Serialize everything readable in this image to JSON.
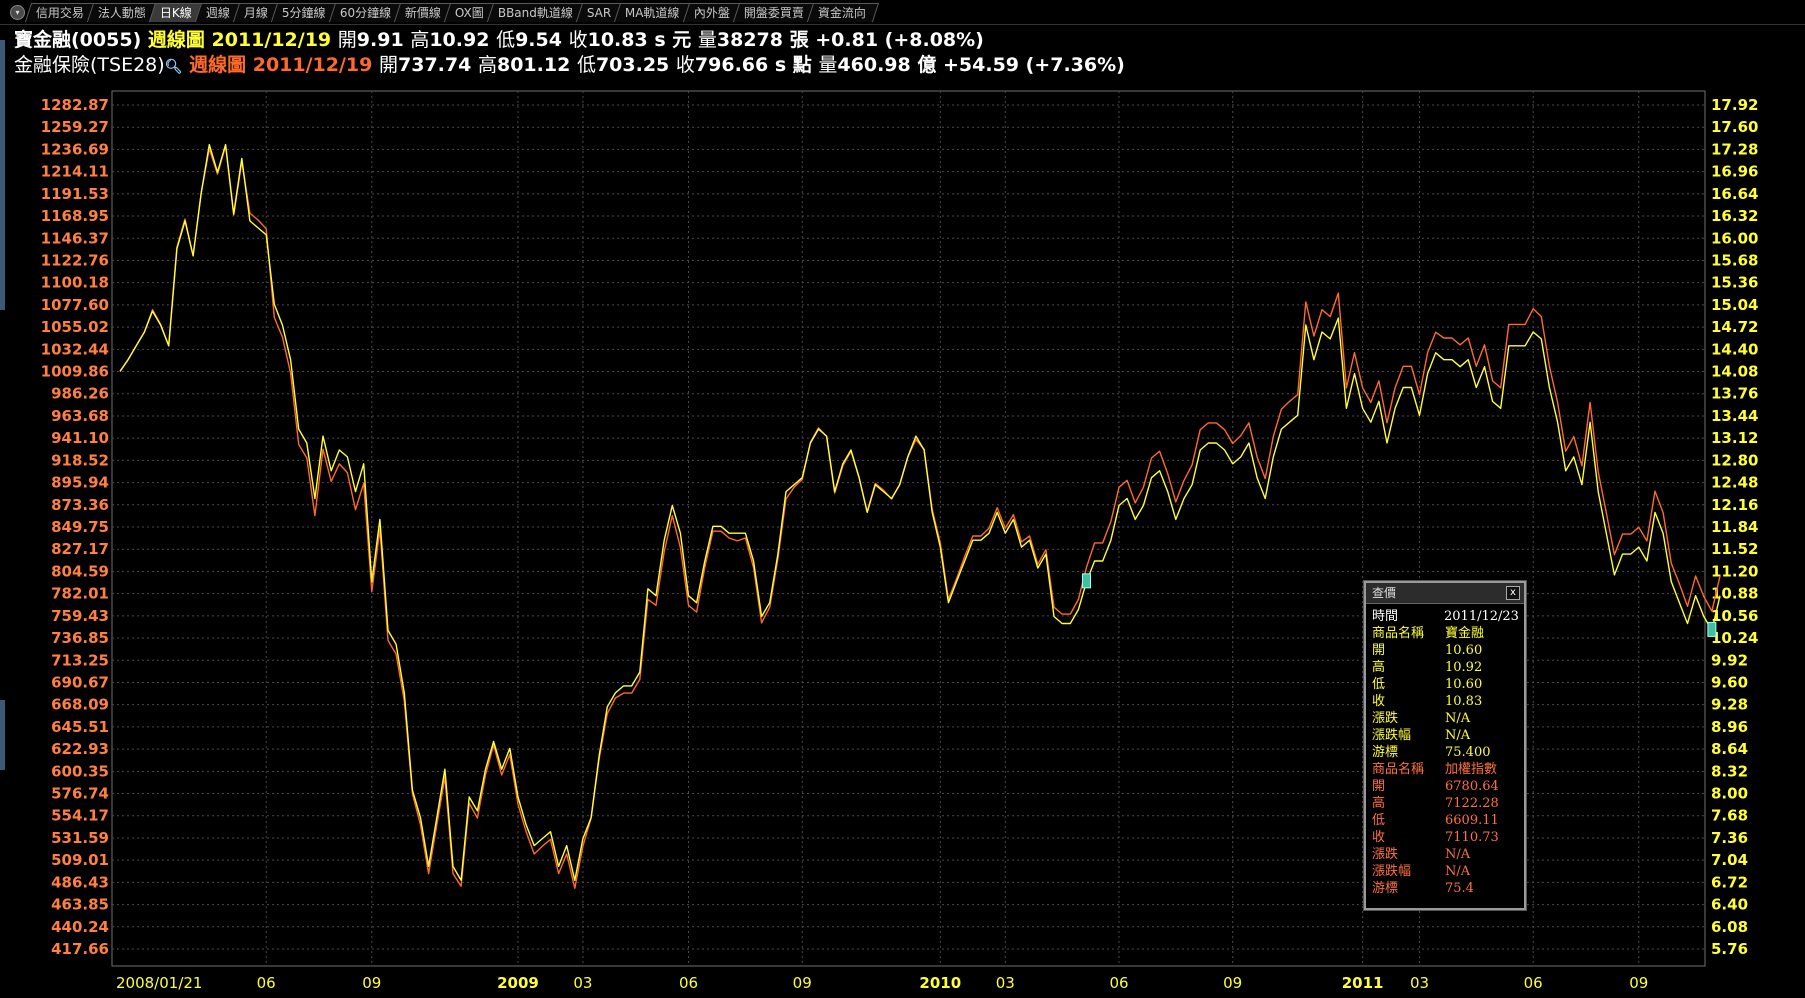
{
  "tabs": [
    {
      "label": "信用交易",
      "active": false
    },
    {
      "label": "法人動態",
      "active": false
    },
    {
      "label": "日K線",
      "active": true
    },
    {
      "label": "週線",
      "active": false
    },
    {
      "label": "月線",
      "active": false
    },
    {
      "label": "5分鐘線",
      "active": false
    },
    {
      "label": "60分鐘線",
      "active": false
    },
    {
      "label": "新價線",
      "active": false
    },
    {
      "label": "OX圖",
      "active": false
    },
    {
      "label": "BBand軌道線",
      "active": false
    },
    {
      "label": "SAR",
      "active": false
    },
    {
      "label": "MA軌道線",
      "active": false
    },
    {
      "label": "內外盤",
      "active": false
    },
    {
      "label": "開盤委買賣",
      "active": false
    },
    {
      "label": "資金流向",
      "active": false
    }
  ],
  "stock": {
    "name": "寶金融(0055)",
    "period": "週線圖",
    "date": "2011/12/19",
    "open_label": "開",
    "open": "9.91",
    "high_label": "高",
    "high": "10.92",
    "low_label": "低",
    "low": "9.54",
    "close_label": "收",
    "close": "10.83 s 元",
    "vol_label": "量",
    "vol": "38278 張",
    "change": "+0.81 (+8.08%)"
  },
  "index": {
    "name": "金融保險(TSE28)",
    "period": "週線圖",
    "date": "2011/12/19",
    "open_label": "開",
    "open": "737.74",
    "high_label": "高",
    "high": "801.12",
    "low_label": "低",
    "low": "703.25",
    "close_label": "收",
    "close": "796.66 s 點",
    "vol_label": "量",
    "vol": "460.98 億",
    "change": "+54.59 (+7.36%)"
  },
  "popup": {
    "title": "查價",
    "close": "x",
    "rows": [
      {
        "k": "時間",
        "v": "2011/12/23",
        "c": "w"
      },
      {
        "k": "商品名稱",
        "v": "寶金融",
        "c": "y"
      },
      {
        "k": "開",
        "v": "10.60",
        "c": "y"
      },
      {
        "k": "高",
        "v": "10.92",
        "c": "y"
      },
      {
        "k": "低",
        "v": "10.60",
        "c": "y"
      },
      {
        "k": "收",
        "v": "10.83",
        "c": "y"
      },
      {
        "k": "漲跌",
        "v": "N/A",
        "c": "y"
      },
      {
        "k": "漲跌幅",
        "v": "N/A",
        "c": "y"
      },
      {
        "k": "游標",
        "v": "75.400",
        "c": "y"
      },
      {
        "k": "商品名稱",
        "v": "加權指數",
        "c": "o"
      },
      {
        "k": "開",
        "v": "6780.64",
        "c": "o"
      },
      {
        "k": "高",
        "v": "7122.28",
        "c": "o"
      },
      {
        "k": "低",
        "v": "6609.11",
        "c": "o"
      },
      {
        "k": "收",
        "v": "7110.73",
        "c": "o"
      },
      {
        "k": "漲跌",
        "v": "N/A",
        "c": "o"
      },
      {
        "k": "漲跌幅",
        "v": "N/A",
        "c": "o"
      },
      {
        "k": "游標",
        "v": "75.4",
        "c": "o"
      }
    ]
  },
  "chart_data": {
    "type": "line",
    "title": "",
    "xlabel": "",
    "ylabel": "",
    "grid": true,
    "x_ticks": [
      {
        "label": "2008/01/21",
        "i": 0,
        "bold": false
      },
      {
        "label": "06",
        "i": 18,
        "bold": false
      },
      {
        "label": "09",
        "i": 31,
        "bold": false
      },
      {
        "label": "2009",
        "i": 49,
        "bold": true
      },
      {
        "label": "03",
        "i": 57,
        "bold": false
      },
      {
        "label": "06",
        "i": 70,
        "bold": false
      },
      {
        "label": "09",
        "i": 84,
        "bold": false
      },
      {
        "label": "2010",
        "i": 101,
        "bold": true
      },
      {
        "label": "03",
        "i": 109,
        "bold": false
      },
      {
        "label": "06",
        "i": 123,
        "bold": false
      },
      {
        "label": "09",
        "i": 137,
        "bold": false
      },
      {
        "label": "2011",
        "i": 153,
        "bold": true
      },
      {
        "label": "03",
        "i": 160,
        "bold": false
      },
      {
        "label": "06",
        "i": 174,
        "bold": false
      },
      {
        "label": "09",
        "i": 187,
        "bold": false
      }
    ],
    "left_axis": {
      "color": "#ff8040",
      "ylim": [
        417.66,
        1282.87
      ],
      "ticks": [
        "1282.87",
        "1259.27",
        "1236.69",
        "1214.11",
        "1191.53",
        "1168.95",
        "1146.37",
        "1122.76",
        "1100.18",
        "1077.60",
        "1055.02",
        "1032.44",
        "1009.86",
        "986.26",
        "963.68",
        "941.10",
        "918.52",
        "895.94",
        "873.36",
        "849.75",
        "827.17",
        "804.59",
        "782.01",
        "759.43",
        "736.85",
        "713.25",
        "690.67",
        "668.09",
        "645.51",
        "622.93",
        "600.35",
        "576.74",
        "554.17",
        "531.59",
        "509.01",
        "486.43",
        "463.85",
        "440.24",
        "417.66"
      ]
    },
    "right_axis": {
      "color": "#ffff33",
      "ylim": [
        5.76,
        17.92
      ],
      "ticks": [
        "17.92",
        "17.60",
        "17.28",
        "16.96",
        "16.64",
        "16.32",
        "16.00",
        "15.68",
        "15.36",
        "15.04",
        "14.72",
        "14.40",
        "14.08",
        "13.76",
        "13.44",
        "13.12",
        "12.80",
        "12.48",
        "12.16",
        "11.84",
        "11.52",
        "11.20",
        "10.88",
        "10.56",
        "10.24",
        "9.92",
        "9.60",
        "9.28",
        "8.96",
        "8.64",
        "8.32",
        "8.00",
        "7.68",
        "7.36",
        "7.04",
        "6.72",
        "6.40",
        "6.08",
        "5.76"
      ]
    },
    "series": [
      {
        "name": "寶金融(0055)",
        "color": "#ffff33",
        "axis": "right",
        "values": [
          14.08,
          14.25,
          14.45,
          14.65,
          14.95,
          14.75,
          14.45,
          15.85,
          16.25,
          15.75,
          16.65,
          17.35,
          16.95,
          17.35,
          16.35,
          17.15,
          16.25,
          16.15,
          16.05,
          15.05,
          14.75,
          14.25,
          13.25,
          13.05,
          12.25,
          13.15,
          12.65,
          12.95,
          12.85,
          12.35,
          12.75,
          11.05,
          11.95,
          10.35,
          10.15,
          9.45,
          8.05,
          7.65,
          6.95,
          7.65,
          8.35,
          6.95,
          6.75,
          7.95,
          7.75,
          8.35,
          8.75,
          8.35,
          8.65,
          7.95,
          7.55,
          7.25,
          7.35,
          7.45,
          6.95,
          7.25,
          6.75,
          7.35,
          7.65,
          8.55,
          9.25,
          9.45,
          9.55,
          9.55,
          9.75,
          10.95,
          10.85,
          11.65,
          12.15,
          11.75,
          10.85,
          10.75,
          11.35,
          11.85,
          11.85,
          11.75,
          11.75,
          11.75,
          11.35,
          10.55,
          10.75,
          11.45,
          12.35,
          12.45,
          12.55,
          13.05,
          13.25,
          13.15,
          12.35,
          12.75,
          12.95,
          12.55,
          12.05,
          12.45,
          12.35,
          12.25,
          12.45,
          12.85,
          13.15,
          12.95,
          12.05,
          11.55,
          10.75,
          11.05,
          11.35,
          11.65,
          11.65,
          11.75,
          12.05,
          11.75,
          11.95,
          11.55,
          11.65,
          11.25,
          11.45,
          10.55,
          10.45,
          10.45,
          10.65,
          11.05,
          11.35,
          11.35,
          11.65,
          12.15,
          12.25,
          11.95,
          12.15,
          12.55,
          12.65,
          12.35,
          11.95,
          12.25,
          12.45,
          12.95,
          13.05,
          13.05,
          12.95,
          12.75,
          12.85,
          13.05,
          12.55,
          12.25,
          12.85,
          13.25,
          13.35,
          13.45,
          14.75,
          14.25,
          14.65,
          14.55,
          14.85,
          13.55,
          14.05,
          13.55,
          13.35,
          13.65,
          13.05,
          13.55,
          13.85,
          13.85,
          13.45,
          14.05,
          14.35,
          14.25,
          14.25,
          14.15,
          14.25,
          13.85,
          14.15,
          13.65,
          13.55,
          14.45,
          14.45,
          14.45,
          14.65,
          14.55,
          13.85,
          13.35,
          12.65,
          12.85,
          12.45,
          13.35,
          12.35,
          11.75,
          11.15,
          11.45,
          11.45,
          11.55,
          11.35,
          12.05,
          11.75,
          11.05,
          10.75,
          10.45,
          10.85,
          10.55,
          10.35,
          10.85
        ]
      },
      {
        "name": "金融保險(TSE28)",
        "color": "#ff6a2a",
        "axis": "left",
        "values": [
          1010,
          1022,
          1036,
          1050,
          1073,
          1058,
          1036,
          1137,
          1166,
          1128,
          1193,
          1238,
          1212,
          1241,
          1170,
          1225,
          1172,
          1165,
          1156,
          1065,
          1045,
          1008,
          935,
          921,
          862,
          930,
          897,
          915,
          906,
          868,
          895,
          784,
          848,
          734,
          720,
          672,
          577,
          545,
          495,
          545,
          594,
          495,
          482,
          567,
          552,
          596,
          627,
          596,
          617,
          566,
          538,
          515,
          523,
          530,
          495,
          515,
          480,
          523,
          552,
          613,
          659,
          675,
          680,
          680,
          694,
          776,
          770,
          825,
          862,
          829,
          770,
          763,
          809,
          846,
          846,
          839,
          836,
          839,
          809,
          752,
          768,
          818,
          879,
          891,
          899,
          937,
          952,
          943,
          885,
          913,
          928,
          901,
          866,
          895,
          888,
          879,
          894,
          922,
          940,
          930,
          868,
          834,
          776,
          797,
          820,
          841,
          841,
          849,
          870,
          849,
          863,
          835,
          841,
          812,
          827,
          768,
          761,
          761,
          776,
          809,
          834,
          834,
          856,
          891,
          898,
          875,
          891,
          921,
          928,
          905,
          876,
          898,
          914,
          950,
          957,
          957,
          950,
          936,
          944,
          957,
          922,
          900,
          943,
          971,
          979,
          986,
          1081,
          1046,
          1073,
          1066,
          1090,
          993,
          1029,
          993,
          978,
          1000,
          957,
          993,
          1015,
          1015,
          986,
          1029,
          1050,
          1044,
          1044,
          1037,
          1044,
          1015,
          1037,
          1000,
          993,
          1058,
          1058,
          1058,
          1074,
          1066,
          1015,
          978,
          928,
          943,
          913,
          978,
          907,
          865,
          822,
          843,
          843,
          850,
          836,
          887,
          865,
          813,
          792,
          769,
          800,
          779,
          764,
          800
        ]
      }
    ]
  }
}
